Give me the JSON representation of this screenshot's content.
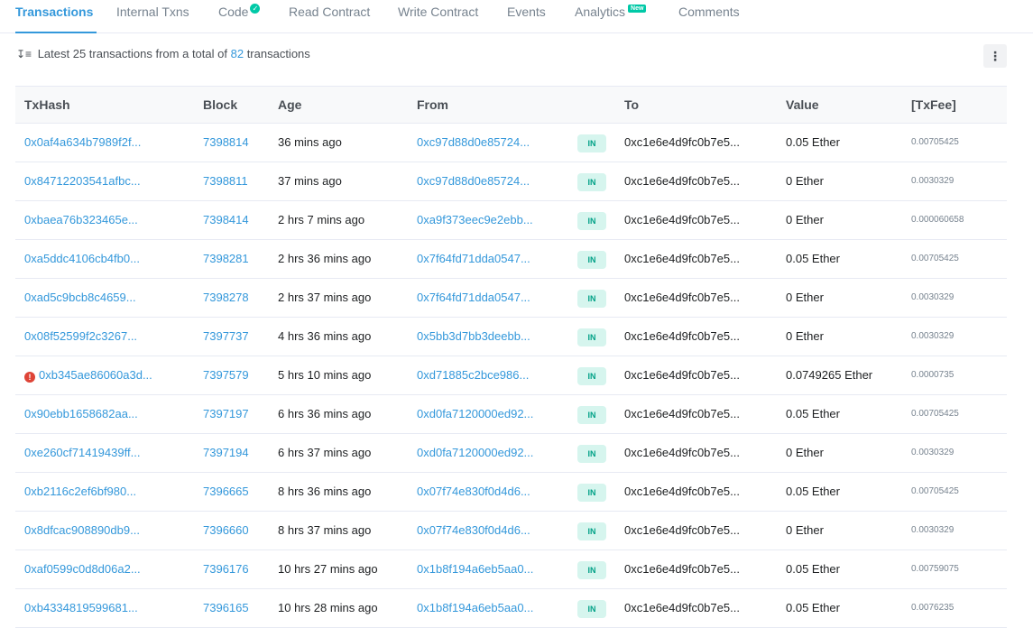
{
  "tabs": [
    {
      "label": "Transactions",
      "active": true
    },
    {
      "label": "Internal Txns"
    },
    {
      "label": "Code",
      "verified": true
    },
    {
      "label": "Read Contract"
    },
    {
      "label": "Write Contract"
    },
    {
      "label": "Events"
    },
    {
      "label": "Analytics",
      "badge": "New"
    },
    {
      "label": "Comments"
    }
  ],
  "summary": {
    "prefix": "Latest 25 transactions from a total of",
    "count": "82",
    "suffix": "transactions"
  },
  "columns": [
    "TxHash",
    "Block",
    "Age",
    "From",
    "",
    "To",
    "Value",
    "[TxFee]"
  ],
  "direction_label": "IN",
  "rows": [
    {
      "hash": "0x0af4a634b7989f2f...",
      "block": "7398814",
      "age": "36 mins ago",
      "from": "0xc97d88d0e85724...",
      "to": "0xc1e6e4d9fc0b7e5...",
      "value": "0.05 Ether",
      "fee": "0.00705425",
      "error": false
    },
    {
      "hash": "0x84712203541afbc...",
      "block": "7398811",
      "age": "37 mins ago",
      "from": "0xc97d88d0e85724...",
      "to": "0xc1e6e4d9fc0b7e5...",
      "value": "0 Ether",
      "fee": "0.0030329",
      "error": false
    },
    {
      "hash": "0xbaea76b323465e...",
      "block": "7398414",
      "age": "2 hrs 7 mins ago",
      "from": "0xa9f373eec9e2ebb...",
      "to": "0xc1e6e4d9fc0b7e5...",
      "value": "0 Ether",
      "fee": "0.000060658",
      "error": false
    },
    {
      "hash": "0xa5ddc4106cb4fb0...",
      "block": "7398281",
      "age": "2 hrs 36 mins ago",
      "from": "0x7f64fd71dda0547...",
      "to": "0xc1e6e4d9fc0b7e5...",
      "value": "0.05 Ether",
      "fee": "0.00705425",
      "error": false
    },
    {
      "hash": "0xad5c9bcb8c4659...",
      "block": "7398278",
      "age": "2 hrs 37 mins ago",
      "from": "0x7f64fd71dda0547...",
      "to": "0xc1e6e4d9fc0b7e5...",
      "value": "0 Ether",
      "fee": "0.0030329",
      "error": false
    },
    {
      "hash": "0x08f52599f2c3267...",
      "block": "7397737",
      "age": "4 hrs 36 mins ago",
      "from": "0x5bb3d7bb3deebb...",
      "to": "0xc1e6e4d9fc0b7e5...",
      "value": "0 Ether",
      "fee": "0.0030329",
      "error": false
    },
    {
      "hash": "0xb345ae86060a3d...",
      "block": "7397579",
      "age": "5 hrs 10 mins ago",
      "from": "0xd71885c2bce986...",
      "to": "0xc1e6e4d9fc0b7e5...",
      "value": "0.0749265 Ether",
      "fee": "0.0000735",
      "error": true
    },
    {
      "hash": "0x90ebb1658682aa...",
      "block": "7397197",
      "age": "6 hrs 36 mins ago",
      "from": "0xd0fa7120000ed92...",
      "to": "0xc1e6e4d9fc0b7e5...",
      "value": "0.05 Ether",
      "fee": "0.00705425",
      "error": false
    },
    {
      "hash": "0xe260cf71419439ff...",
      "block": "7397194",
      "age": "6 hrs 37 mins ago",
      "from": "0xd0fa7120000ed92...",
      "to": "0xc1e6e4d9fc0b7e5...",
      "value": "0 Ether",
      "fee": "0.0030329",
      "error": false
    },
    {
      "hash": "0xb2116c2ef6bf980...",
      "block": "7396665",
      "age": "8 hrs 36 mins ago",
      "from": "0x07f74e830f0d4d6...",
      "to": "0xc1e6e4d9fc0b7e5...",
      "value": "0.05 Ether",
      "fee": "0.00705425",
      "error": false
    },
    {
      "hash": "0x8dfcac908890db9...",
      "block": "7396660",
      "age": "8 hrs 37 mins ago",
      "from": "0x07f74e830f0d4d6...",
      "to": "0xc1e6e4d9fc0b7e5...",
      "value": "0 Ether",
      "fee": "0.0030329",
      "error": false
    },
    {
      "hash": "0xaf0599c0d8d06a2...",
      "block": "7396176",
      "age": "10 hrs 27 mins ago",
      "from": "0x1b8f194a6eb5aa0...",
      "to": "0xc1e6e4d9fc0b7e5...",
      "value": "0.05 Ether",
      "fee": "0.00759075",
      "error": false
    },
    {
      "hash": "0xb4334819599681...",
      "block": "7396165",
      "age": "10 hrs 28 mins ago",
      "from": "0x1b8f194a6eb5aa0...",
      "to": "0xc1e6e4d9fc0b7e5...",
      "value": "0.05 Ether",
      "fee": "0.0076235",
      "error": false
    }
  ]
}
